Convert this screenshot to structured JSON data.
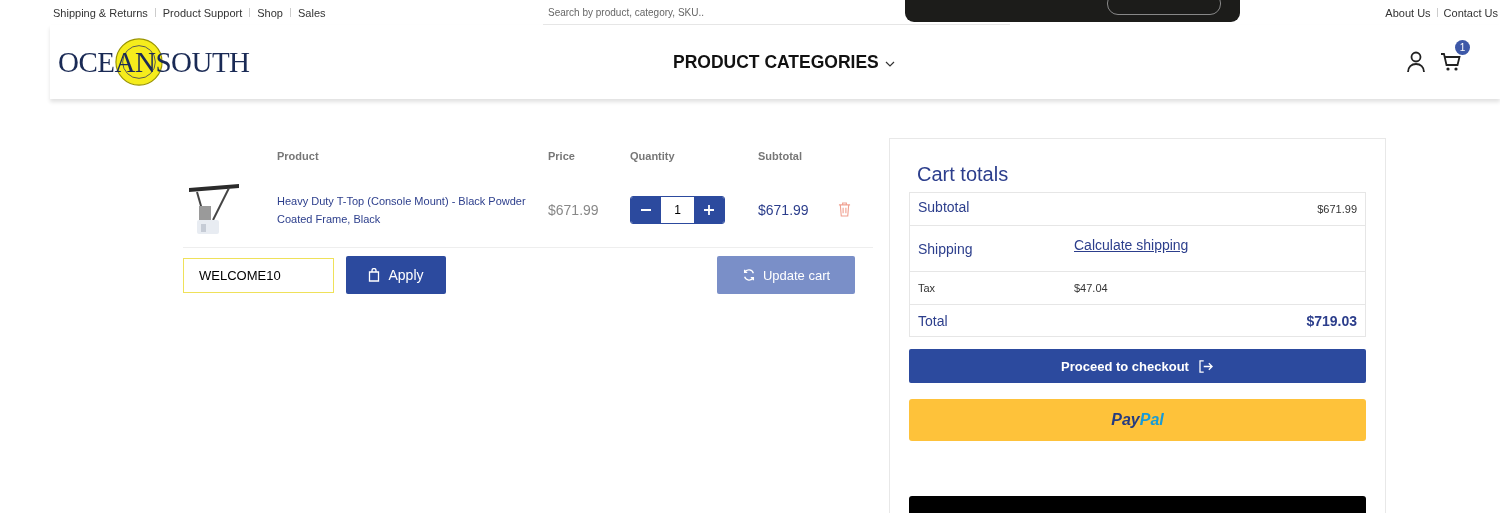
{
  "top_links_left": [
    "Shipping & Returns",
    "Product Support",
    "Shop",
    "Sales"
  ],
  "search": {
    "placeholder": "Search by product, category, SKU.."
  },
  "top_links_right": [
    "About Us",
    "Contact Us"
  ],
  "logo": {
    "text": "OCEANSOUTH"
  },
  "nav": {
    "label": "PRODUCT CATEGORIES"
  },
  "cart_badge": "1",
  "cart_table": {
    "columns": [
      "Product",
      "Price",
      "Quantity",
      "Subtotal"
    ],
    "rows": [
      {
        "product": "Heavy Duty T-Top (Console Mount) - Black Powder Coated Frame, Black",
        "price": "$671.99",
        "quantity": "1",
        "subtotal": "$671.99"
      }
    ]
  },
  "coupon": {
    "value": "WELCOME10",
    "focused": true,
    "apply_label": "Apply"
  },
  "update_cart": {
    "label": "Update cart",
    "disabled": true
  },
  "cart_totals": {
    "title": "Cart totals",
    "rows": [
      {
        "kind": "amount",
        "label": "Subtotal",
        "value": "$671.99"
      },
      {
        "kind": "link",
        "label": "Shipping",
        "value": "Calculate shipping"
      },
      {
        "kind": "small",
        "label": "Tax",
        "value": "$47.04"
      },
      {
        "kind": "total",
        "label": "Total",
        "value": "$719.03"
      }
    ],
    "checkout_label": "Proceed to checkout",
    "paypal": [
      {
        "text": "Pay",
        "color": "#253b80"
      },
      {
        "text": "Pal",
        "color": "#179bd7"
      }
    ]
  }
}
